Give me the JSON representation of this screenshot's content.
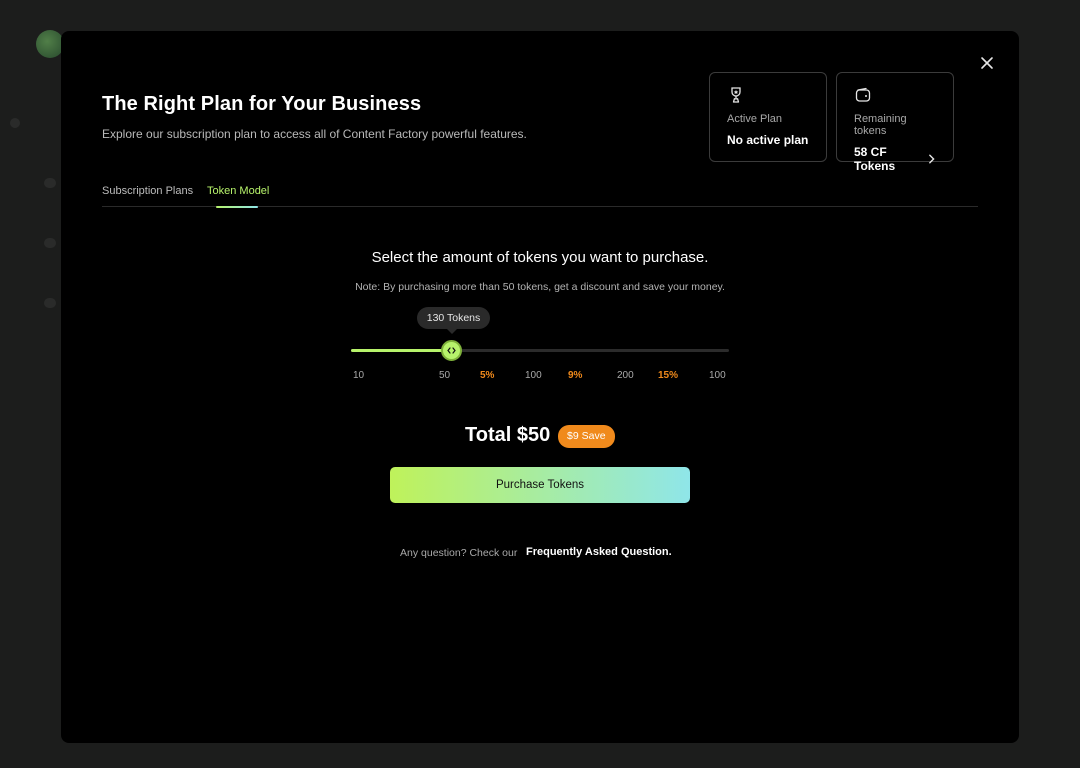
{
  "modal": {
    "title": "The Right Plan for Your Business",
    "subtitle": "Explore our subscription plan to access all of Content Factory powerful features."
  },
  "cards": {
    "active_plan": {
      "icon": "trophy-icon",
      "label": "Active Plan",
      "value": "No active plan"
    },
    "remaining_tokens": {
      "icon": "wallet-icon",
      "label": "Remaining tokens",
      "value": "58 CF Tokens"
    }
  },
  "tabs": [
    {
      "label": "Subscription Plans",
      "active": false
    },
    {
      "label": "Token Model",
      "active": true
    }
  ],
  "token_panel": {
    "heading": "Select the amount of tokens you want to purchase.",
    "note": "Note: By purchasing more than 50 tokens, get a discount and save your money.",
    "slider": {
      "tooltip": "130 Tokens",
      "fill_fraction": 0.27,
      "ticks": [
        {
          "label": "10",
          "discount": false
        },
        {
          "label": "50",
          "discount": false
        },
        {
          "label": "5%",
          "discount": true
        },
        {
          "label": "100",
          "discount": false
        },
        {
          "label": "9%",
          "discount": true
        },
        {
          "label": "200",
          "discount": false
        },
        {
          "label": "15%",
          "discount": true
        },
        {
          "label": "100",
          "discount": false
        }
      ]
    },
    "total": "Total $50",
    "save_badge": "$9 Save",
    "purchase_button": "Purchase Tokens",
    "faq_text": "Any question? Check our",
    "faq_link": "Frequently Asked Question."
  },
  "colors": {
    "accent_green": "#b7f36b",
    "accent_cyan": "#8fe6e9",
    "discount_orange": "#f08a1c",
    "modal_bg": "#000000"
  }
}
